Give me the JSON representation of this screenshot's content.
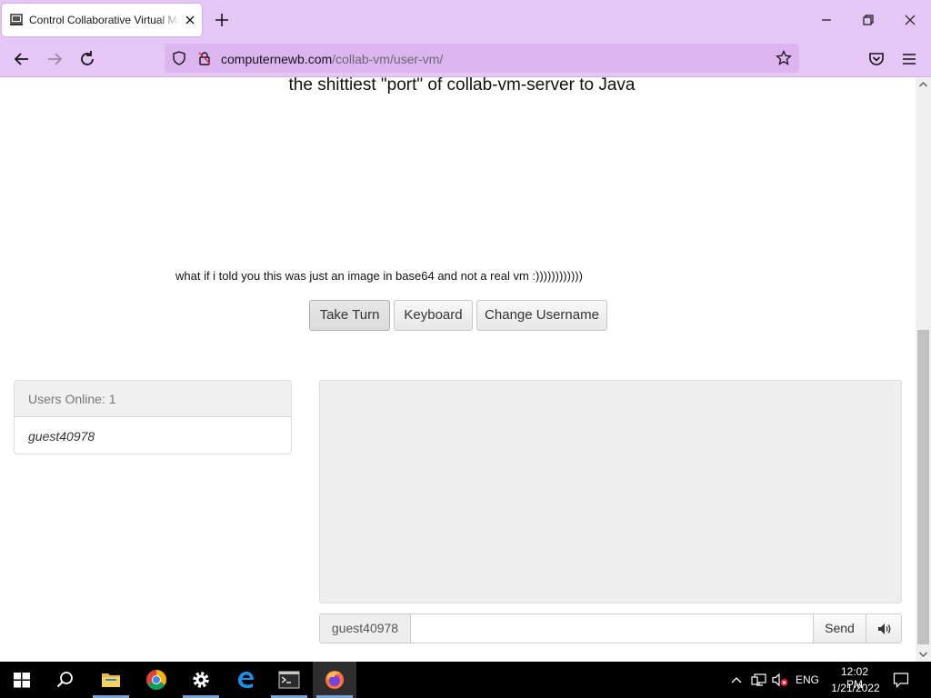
{
  "browser": {
    "tab_title": "Control Collaborative Virtual Machines",
    "url_domain": "computernewb.com",
    "url_path": "/collab-vm/user-vm/"
  },
  "page": {
    "heading": "the shittiest \"port\" of collab-vm-server to Java",
    "subtext": "what if i told you this was just an image in base64 and not a real vm :))))))))))))",
    "buttons": {
      "take_turn": "Take Turn",
      "keyboard": "Keyboard",
      "change_username": "Change Username"
    },
    "users": {
      "header": "Users Online: 1",
      "list": [
        "guest40978"
      ]
    },
    "chat": {
      "username": "guest40978",
      "input_value": "",
      "send_label": "Send"
    }
  },
  "taskbar": {
    "apps": [
      "start-icon",
      "search-icon",
      "file-explorer-icon",
      "chrome-icon",
      "settings-icon",
      "edge-icon",
      "terminal-icon",
      "firefox-icon"
    ],
    "language": "ENG",
    "time": "12:02 PM",
    "date": "1/21/2022"
  },
  "colors": {
    "chrome_bg": "#e5c6f5",
    "urlbar_bg": "#dcb5ef",
    "chat_bg": "#eeeeee",
    "taskbar_bg": "#000000"
  }
}
